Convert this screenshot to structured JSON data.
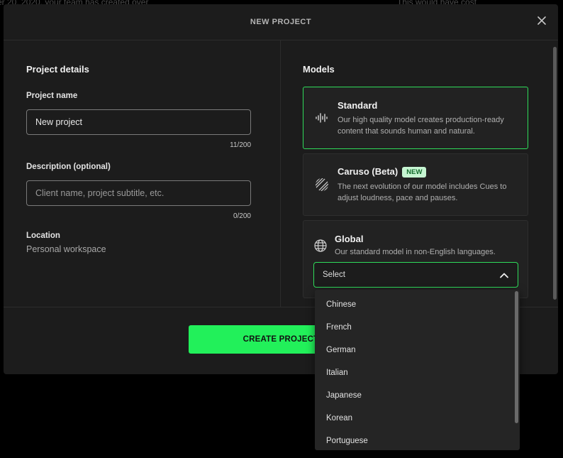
{
  "background": {
    "left_text": "er 20, 2020, your team has created over",
    "right_text": "This would have cost"
  },
  "modal": {
    "title": "NEW PROJECT",
    "close_icon": "close-icon",
    "project_details": {
      "heading": "Project details",
      "name_label": "Project name",
      "name_value": "New project",
      "name_counter": "11/200",
      "description_label": "Description (optional)",
      "description_placeholder": "Client name, project subtitle, etc.",
      "description_counter": "0/200",
      "location_label": "Location",
      "location_value": "Personal workspace"
    },
    "models": {
      "heading": "Models",
      "items": [
        {
          "name": "Standard",
          "description": "Our high quality model creates production-ready content that sounds human and natural.",
          "icon": "waveform-icon",
          "selected": true
        },
        {
          "name": "Caruso (Beta)",
          "badge": "NEW",
          "description": "The next evolution of our model includes Cues to adjust loudness, pace and pauses.",
          "icon": "striped-circle-icon",
          "selected": false
        },
        {
          "name": "Global",
          "description": "Our standard model in non-English languages.",
          "icon": "globe-icon",
          "selected": false
        }
      ],
      "language_select": {
        "value": "Select",
        "options": [
          "Chinese",
          "French",
          "German",
          "Italian",
          "Japanese",
          "Korean",
          "Portuguese"
        ]
      }
    },
    "create_button": "CREATE PROJECT"
  },
  "colors": {
    "accent": "#22f05a",
    "selected_border": "#2fdc5a",
    "modal_bg": "#1c1c1c",
    "card_bg": "#222222"
  }
}
